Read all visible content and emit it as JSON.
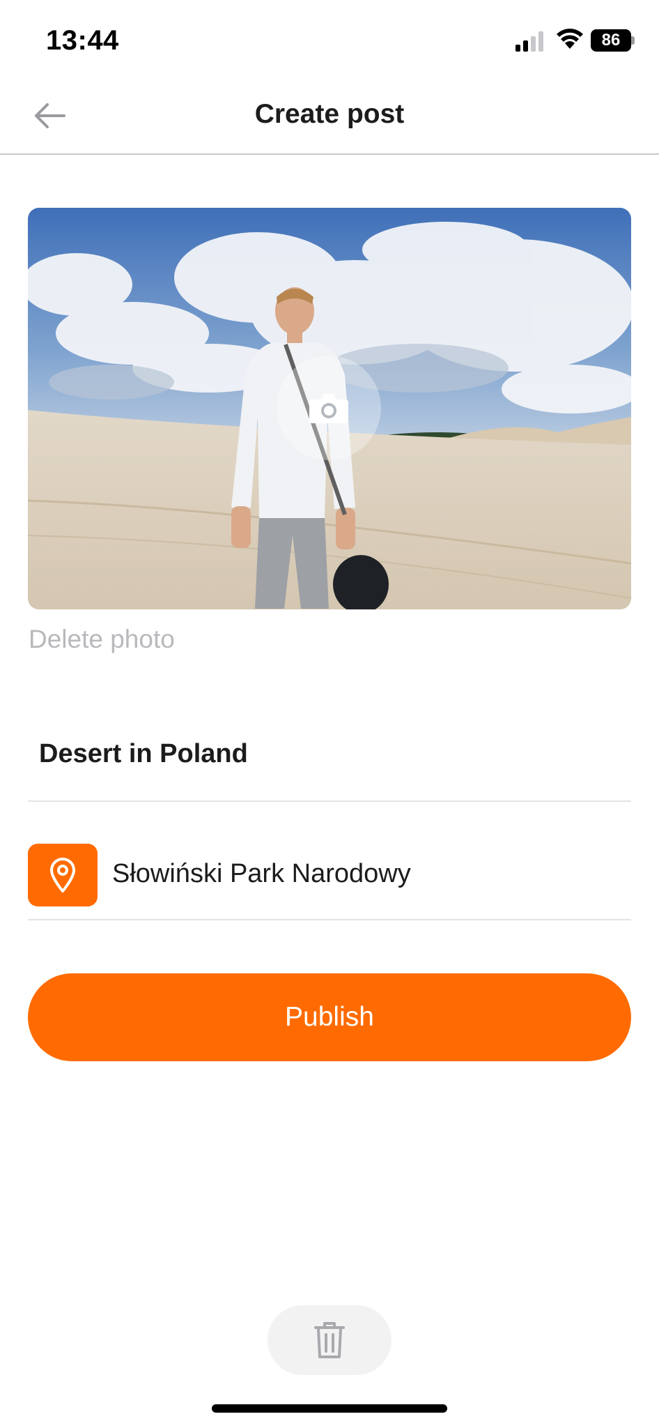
{
  "status_bar": {
    "time": "13:44",
    "battery": "86",
    "icons": [
      "signal-icon",
      "wifi-icon",
      "battery-icon"
    ]
  },
  "header": {
    "title": "Create post",
    "back_icon": "arrow-left-icon"
  },
  "photo": {
    "description_icon": "camera-icon",
    "delete_label": "Delete photo"
  },
  "form": {
    "title_value": "Desert in Poland",
    "location_value": "Słowiński Park Narodowy",
    "location_icon": "map-pin-icon"
  },
  "actions": {
    "publish_label": "Publish",
    "trash_icon": "trash-icon"
  },
  "colors": {
    "accent": "#ff6b00",
    "muted_text": "#b9b9bd",
    "divider": "#e3e3e6"
  }
}
